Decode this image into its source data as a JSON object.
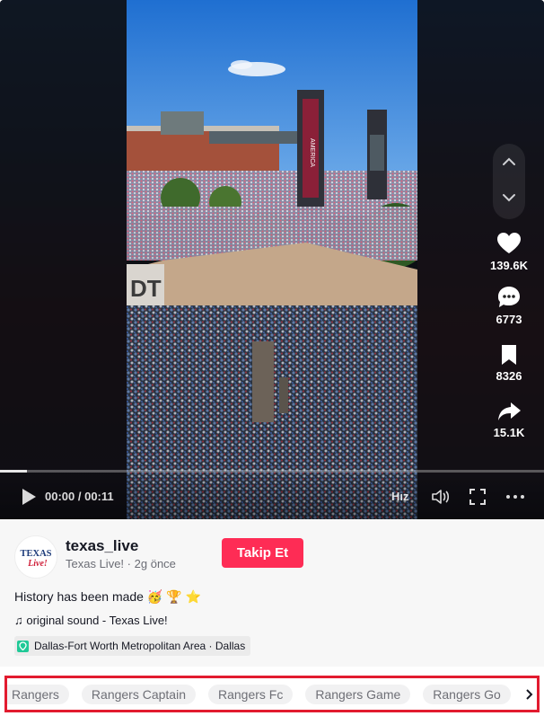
{
  "player": {
    "time": "00:00 / 00:11",
    "progress_fraction": 0.05,
    "speed_label": "Hız",
    "actions": {
      "like_count": "139.6K",
      "comment_count": "6773",
      "save_count": "8326",
      "share_count": "15.1K"
    },
    "scene_text": {
      "stadium_tower_sign": "AMERICA",
      "building_letters": "DT"
    }
  },
  "author": {
    "logo_text": "TEXAS Live!",
    "username": "texas_live",
    "display_name": "Texas Live!",
    "separator": "·",
    "posted": "2g önce",
    "follow_label": "Takip Et"
  },
  "post": {
    "caption": "History has been made 🥳 🏆 ⭐",
    "sound_icon": "♫",
    "sound": "original sound - Texas Live!",
    "location": "Dallas-Fort Worth Metropolitan Area · Dallas"
  },
  "related_tags": [
    "Rangers",
    "Rangers Captain",
    "Rangers Fc",
    "Rangers Game",
    "Rangers Go"
  ],
  "colors": {
    "follow_button": "#fe2c55",
    "highlight_border": "#e21b2f",
    "location_pin": "#20c997"
  }
}
